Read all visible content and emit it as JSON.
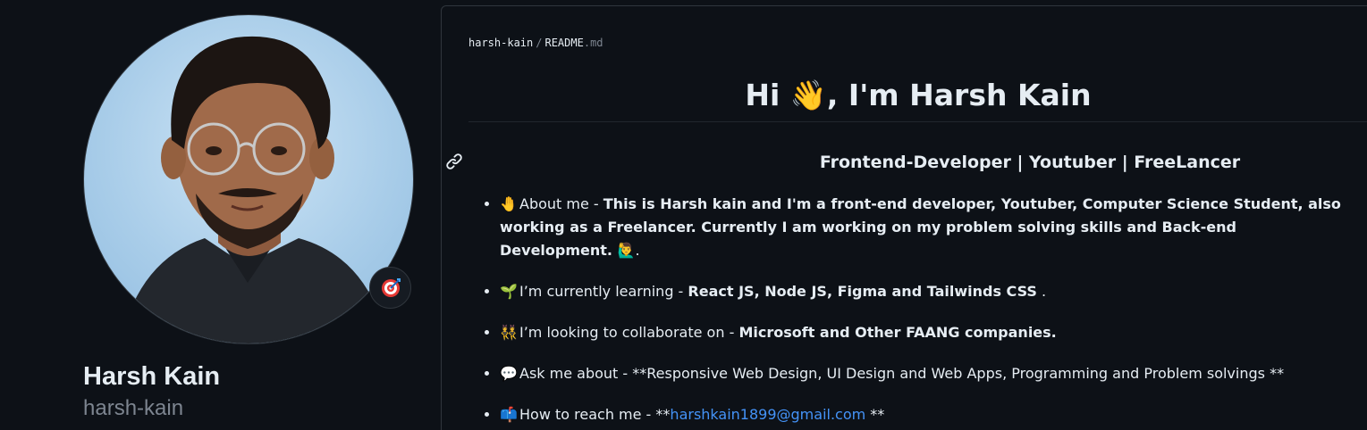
{
  "profile": {
    "name": "Harsh Kain",
    "login": "harsh-kain",
    "status_emoji": "dart-icon"
  },
  "readme": {
    "breadcrumb_user": "harsh-kain",
    "breadcrumb_sep": "/",
    "breadcrumb_file": "README",
    "breadcrumb_ext": ".md",
    "title_pre": "Hi ",
    "title_emoji": "👋",
    "title_post": ", I'm Harsh Kain",
    "subtitle": "Frontend-Developer | Youtuber | FreeLancer",
    "items": [
      {
        "emoji": "🤚",
        "label": "About me - ",
        "bold": "This is Harsh kain and I'm a front-end developer, Youtuber, Computer Science Student, also working as a Freelancer. Currently I am working on my problem solving skills and Back-end Development. 🙋‍♂️",
        "after": "."
      },
      {
        "emoji": "🌱",
        "label": "I’m currently learning - ",
        "bold": "React JS, Node JS, Figma and Tailwinds CSS",
        "after": " ."
      },
      {
        "emoji": "👯",
        "label": "I’m looking to collaborate on - ",
        "bold": "Microsoft and Other FAANG companies.",
        "after": ""
      },
      {
        "emoji": "💬",
        "label": "Ask me about - **Responsive Web Design, UI Design and Web Apps, Programming and Problem solvings **"
      },
      {
        "emoji": "📫",
        "label": "How to reach me - **",
        "link": "harshkain1899@gmail.com",
        "after": " **"
      }
    ]
  },
  "colors": {
    "background": "#0d1117",
    "border": "#30363d",
    "text": "#e6edf3",
    "muted": "#7d8590",
    "link": "#4493f8"
  }
}
